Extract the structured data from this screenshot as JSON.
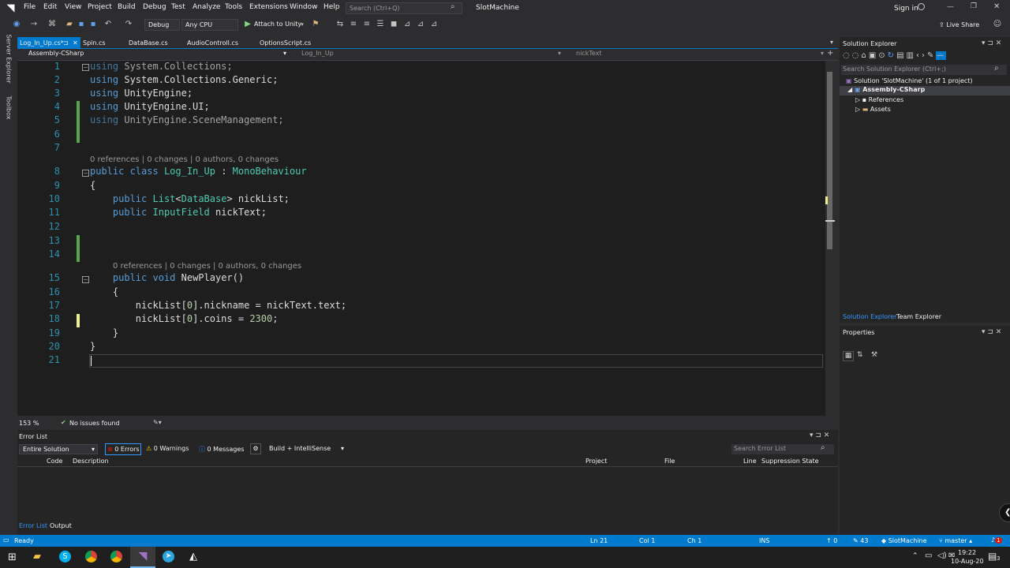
{
  "menu": {
    "items": [
      "File",
      "Edit",
      "View",
      "Project",
      "Build",
      "Debug",
      "Test",
      "Analyze",
      "Tools",
      "Extensions",
      "Window",
      "Help"
    ],
    "search_placeholder": "Search (Ctrl+Q)",
    "solution_name": "SlotMachine",
    "sign_in": "Sign in",
    "live_share": "Live Share"
  },
  "toolbar": {
    "config": "Debug",
    "platform": "Any CPU",
    "attach": "Attach to Unity"
  },
  "tabs": [
    "Log_In_Up.cs*",
    "Spin.cs",
    "DataBase.cs",
    "AudioControll.cs",
    "OptionsScript.cs"
  ],
  "nav": {
    "project": "Assembly-CSharp",
    "class": "Log_In_Up",
    "member": "nickText"
  },
  "side_labels": [
    "Server Explorer",
    "Toolbox"
  ],
  "code": {
    "line_numbers": [
      "1",
      "2",
      "3",
      "4",
      "5",
      "6",
      "7",
      "8",
      "9",
      "10",
      "11",
      "12",
      "13",
      "14",
      "15",
      "16",
      "17",
      "18",
      "19",
      "20",
      "21"
    ],
    "lens1": "0 references | 0 changes | 0 authors, 0 changes",
    "lens2": "0 references | 0 changes | 0 authors, 0 changes"
  },
  "editor_status": {
    "zoom": "153 %",
    "issues": "No issues found"
  },
  "errors": {
    "title": "Error List",
    "scope": "Entire Solution",
    "errors": "0 Errors",
    "warnings": "0 Warnings",
    "messages": "0 Messages",
    "build": "Build + IntelliSense",
    "search_placeholder": "Search Error List",
    "cols": [
      "Code",
      "Description",
      "Project",
      "File",
      "Line",
      "Suppression State"
    ],
    "tabs": [
      "Error List",
      "Output"
    ]
  },
  "solution_explorer": {
    "title": "Solution Explorer",
    "search": "Search Solution Explorer (Ctrl+;)",
    "solution": "Solution 'SlotMachine' (1 of 1 project)",
    "project": "Assembly-CSharp",
    "nodes": [
      "References",
      "Assets"
    ],
    "tabs": [
      "Solution Explorer",
      "Team Explorer"
    ]
  },
  "properties": {
    "title": "Properties"
  },
  "status": {
    "ready": "Ready",
    "ln": "Ln 21",
    "col": "Col 1",
    "ch": "Ch 1",
    "ins": "INS",
    "up": "0",
    "pencil": "43",
    "repo": "SlotMachine",
    "branch": "master",
    "notif": "1"
  },
  "taskbar": {
    "time": "19:22",
    "date": "10-Aug-20",
    "badge": "3"
  }
}
